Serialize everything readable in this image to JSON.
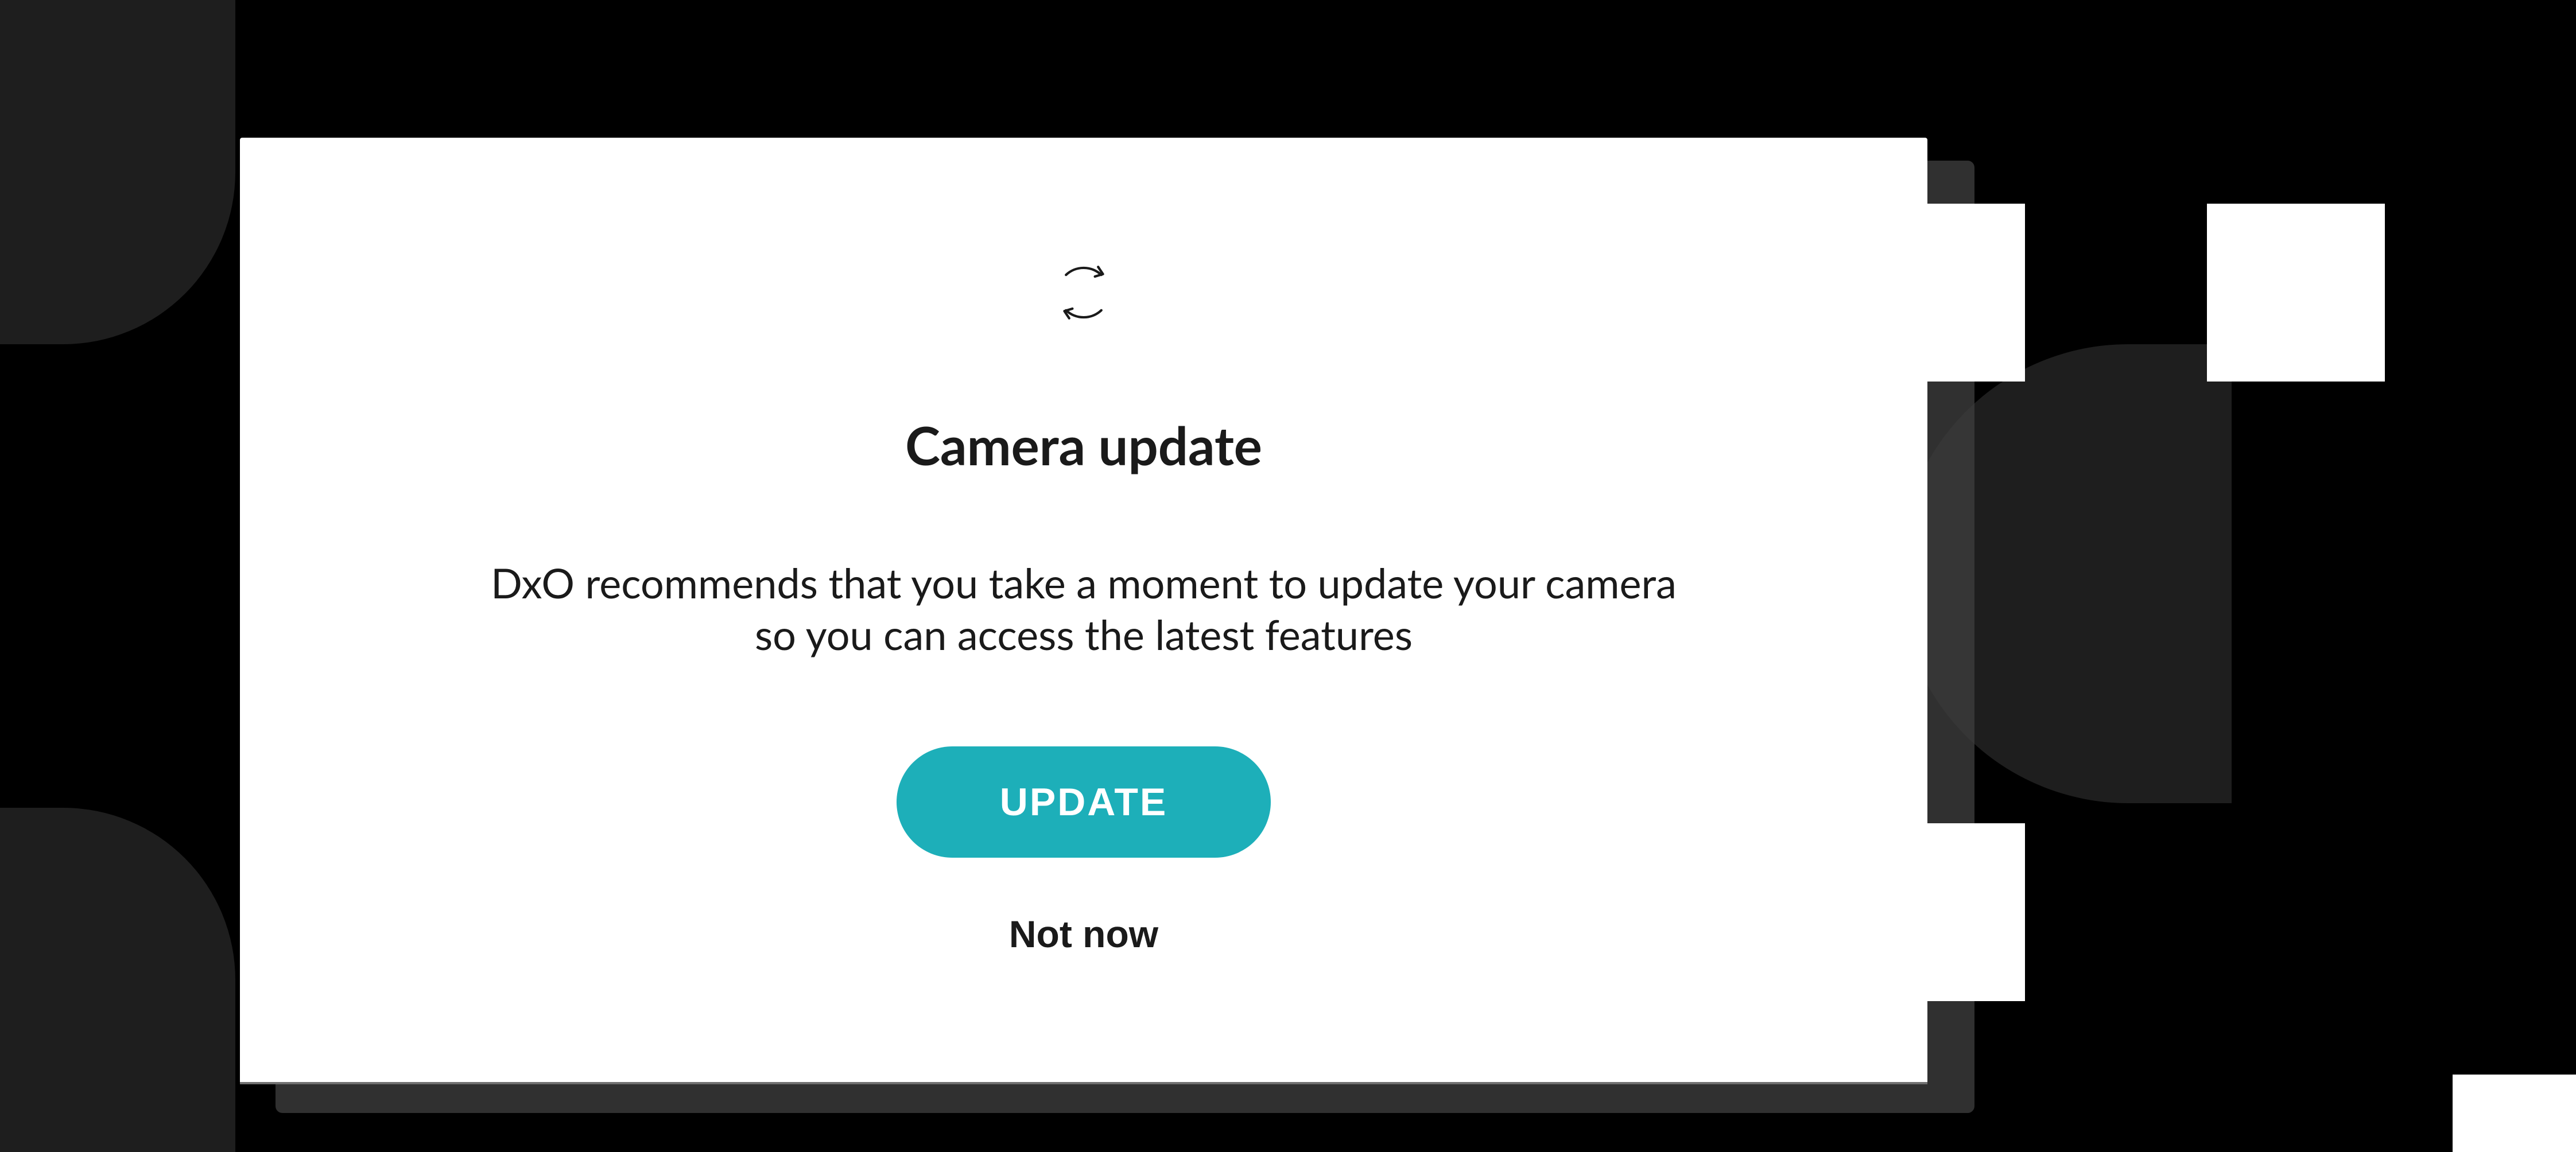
{
  "modal": {
    "title": "Camera update",
    "description_line1": "DxO recommends that you take a moment to update your camera",
    "description_line2": "so you can access the latest features",
    "update_button_label": "UPDATE",
    "not_now_label": "Not now"
  },
  "icons": {
    "refresh": "refresh-icon"
  },
  "colors": {
    "accent": "#1dafb9",
    "background": "#000000",
    "modal_bg": "#ffffff",
    "text": "#1a1a1a"
  }
}
